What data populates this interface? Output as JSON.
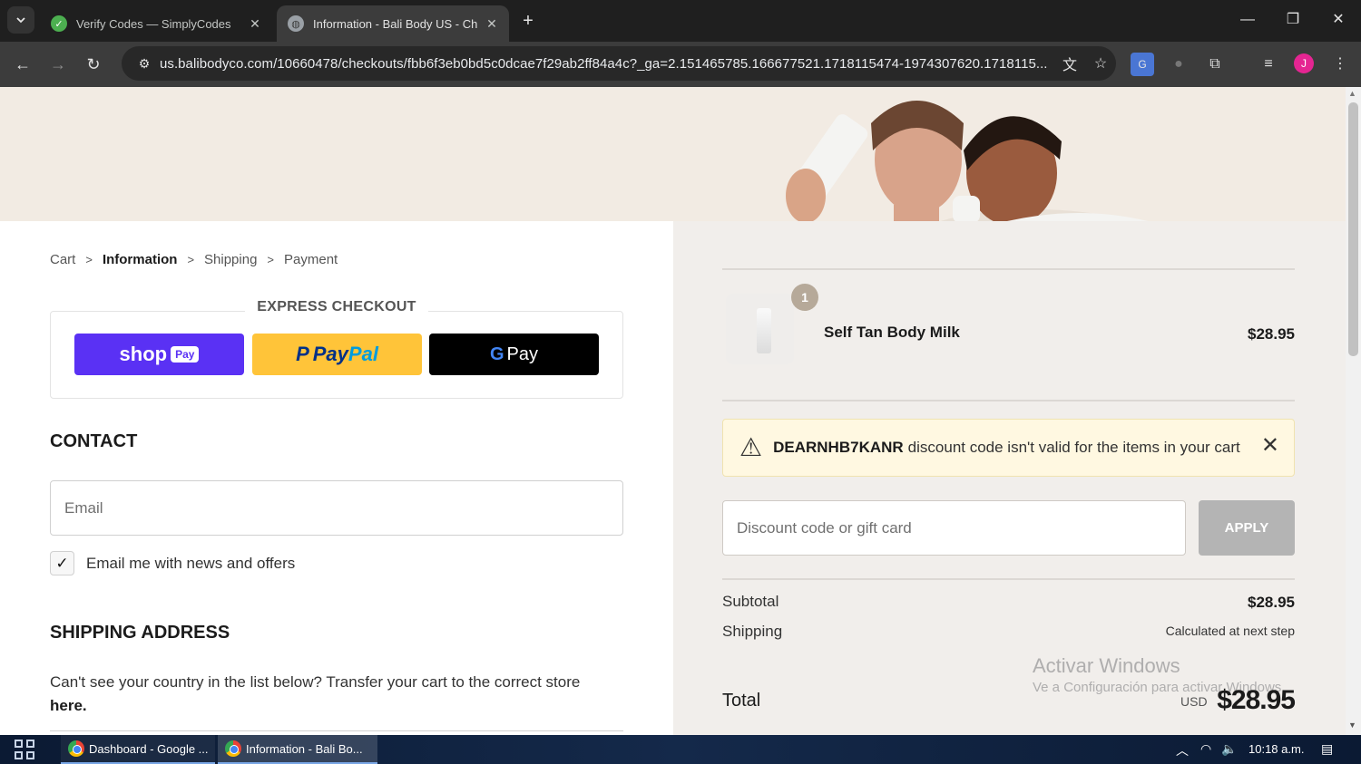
{
  "browser": {
    "tabs": [
      {
        "title": "Verify Codes — SimplyCodes",
        "active": false
      },
      {
        "title": "Information - Bali Body US - Ch",
        "active": true
      }
    ],
    "url": "us.balibodyco.com/10660478/checkouts/fbb6f3eb0bd5c0dcae7f29ab2ff84a4c?_ga=2.151465785.166677521.1718115474-1974307620.1718115...",
    "profile_initial": "J"
  },
  "breadcrumb": [
    "Cart",
    "Information",
    "Shipping",
    "Payment"
  ],
  "express": {
    "title": "EXPRESS CHECKOUT",
    "shop_label": "shop",
    "shop_badge": "Pay",
    "paypal_p": "P",
    "paypal_1": "Pay",
    "paypal_2": "Pal",
    "gpay_g": "G",
    "gpay_label": "Pay"
  },
  "contact": {
    "heading": "CONTACT",
    "email_placeholder": "Email",
    "newsletter_label": "Email me with news and offers",
    "newsletter_checked": true
  },
  "shipping": {
    "heading": "SHIPPING ADDRESS",
    "note": "Can't see your country in the list below? Transfer your cart to the correct store",
    "note_link": "here."
  },
  "order": {
    "quantity": "1",
    "product_name": "Self Tan Body Milk",
    "product_price": "$28.95",
    "alert_code": "DEARNHB7KANR",
    "alert_text": "discount code isn't valid for the items in your cart",
    "discount_placeholder": "Discount code or gift card",
    "apply_label": "APPLY",
    "subtotal_label": "Subtotal",
    "subtotal_value": "$28.95",
    "shipping_label": "Shipping",
    "shipping_value": "Calculated at next step",
    "total_label": "Total",
    "total_currency": "USD",
    "total_value": "$28.95"
  },
  "watermark": {
    "line1": "Activar Windows",
    "line2": "Ve a Configuración para activar Windows."
  },
  "taskbar": {
    "items": [
      "Dashboard - Google ...",
      "Information - Bali Bo..."
    ],
    "time": "10:18 a.m."
  },
  "colors": {
    "shop_pay": "#5a31f4",
    "paypal": "#ffc439",
    "gpay": "#000000",
    "alert_bg": "#fff8e1",
    "apply_disabled": "#b4b4b4"
  }
}
